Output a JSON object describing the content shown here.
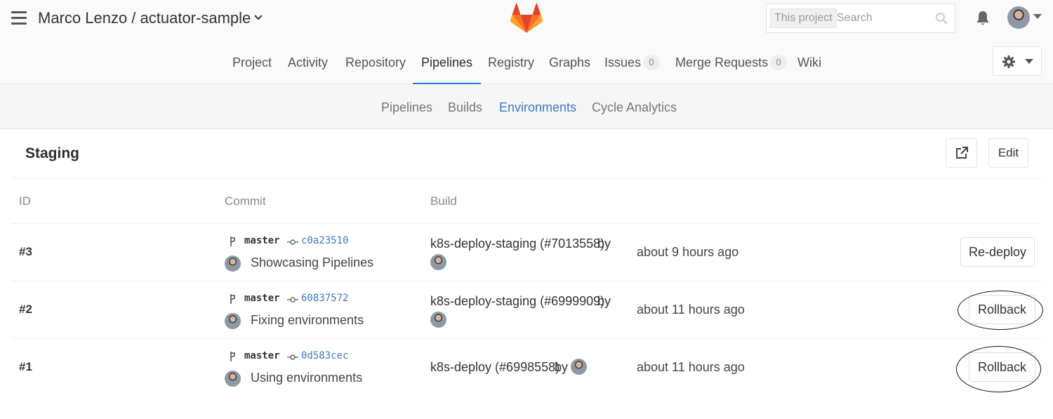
{
  "header": {
    "project_path": "Marco Lenzo / actuator-sample",
    "search_scope": "This project",
    "search_placeholder": "Search"
  },
  "main_nav": [
    {
      "label": "Project"
    },
    {
      "label": "Activity"
    },
    {
      "label": "Repository"
    },
    {
      "label": "Pipelines",
      "active": true
    },
    {
      "label": "Registry"
    },
    {
      "label": "Graphs"
    },
    {
      "label": "Issues",
      "count": "0"
    },
    {
      "label": "Merge Requests",
      "count": "0"
    },
    {
      "label": "Wiki"
    }
  ],
  "sub_nav": [
    {
      "label": "Pipelines"
    },
    {
      "label": "Builds"
    },
    {
      "label": "Environments",
      "active": true
    },
    {
      "label": "Cycle Analytics"
    }
  ],
  "environment": {
    "name": "Staging",
    "edit_label": "Edit"
  },
  "table": {
    "headers": [
      "ID",
      "Commit",
      "Build"
    ],
    "rows": [
      {
        "id": "#3",
        "branch": "master",
        "sha": "c0a23510",
        "message": "Showcasing Pipelines",
        "build": "k8s-deploy-staging (#7013558)",
        "by": "by",
        "time": "about 9 hours ago",
        "action": "Re-deploy"
      },
      {
        "id": "#2",
        "branch": "master",
        "sha": "60837572",
        "message": "Fixing environments",
        "build": "k8s-deploy-staging (#6999909)",
        "by": "by",
        "time": "about 11 hours ago",
        "action": "Rollback"
      },
      {
        "id": "#1",
        "branch": "master",
        "sha": "0d583cec",
        "message": "Using environments",
        "build": "k8s-deploy (#6998558)",
        "by": "by",
        "time": "about 11 hours ago",
        "action": "Rollback"
      }
    ]
  },
  "colors": {
    "accent": "#1f78d1",
    "link": "#3b78c7",
    "logo_dark": "#e24329",
    "logo_mid": "#fc6d26",
    "logo_light": "#fca326"
  }
}
